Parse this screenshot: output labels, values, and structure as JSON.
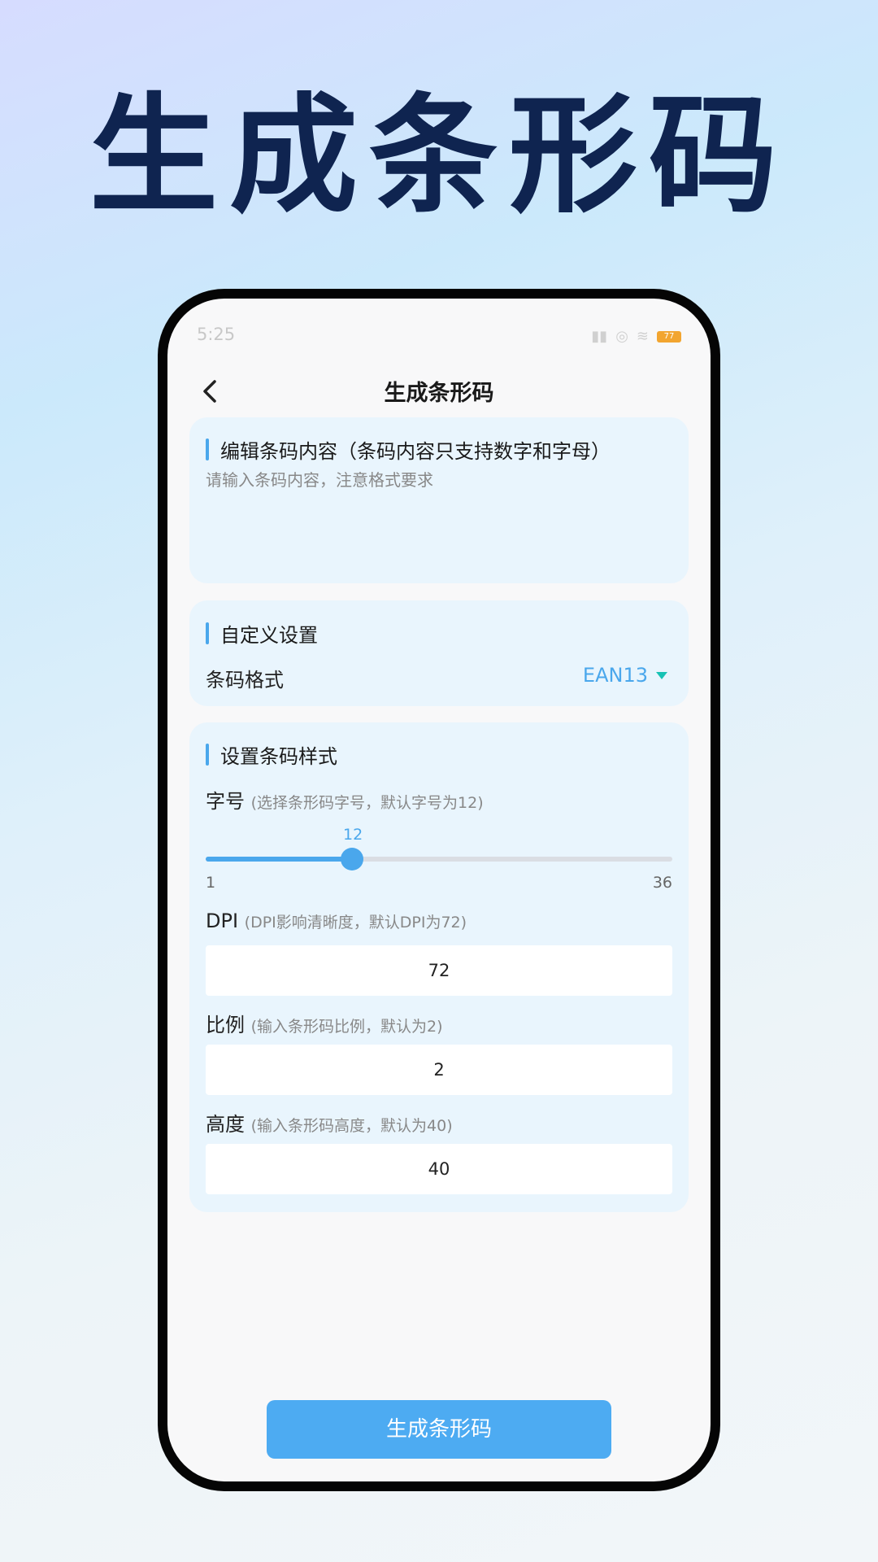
{
  "hero": {
    "title": "生成条形码"
  },
  "status": {
    "time": "5:25",
    "battery": "77"
  },
  "nav": {
    "title": "生成条形码"
  },
  "content_section": {
    "title": "编辑条码内容（条码内容只支持数字和字母）",
    "placeholder": "请输入条码内容，注意格式要求"
  },
  "custom_section": {
    "title": "自定义设置",
    "format_label": "条码格式",
    "format_value": "EAN13"
  },
  "style_section": {
    "title": "设置条码样式",
    "font_label": "字号",
    "font_hint": "(选择条形码字号，默认字号为12)",
    "font_value": "12",
    "font_min": "1",
    "font_max": "36",
    "dpi_label": "DPI",
    "dpi_hint": "(DPI影响清晰度，默认DPI为72)",
    "dpi_value": "72",
    "ratio_label": "比例",
    "ratio_hint": "(输入条形码比例，默认为2)",
    "ratio_value": "2",
    "height_label": "高度",
    "height_hint": "(输入条形码高度，默认为40)",
    "height_value": "40"
  },
  "generate_button": "生成条形码",
  "colors": {
    "accent": "#4aa7ec",
    "title": "#0f2450",
    "dropdown": "#17c2b4"
  }
}
